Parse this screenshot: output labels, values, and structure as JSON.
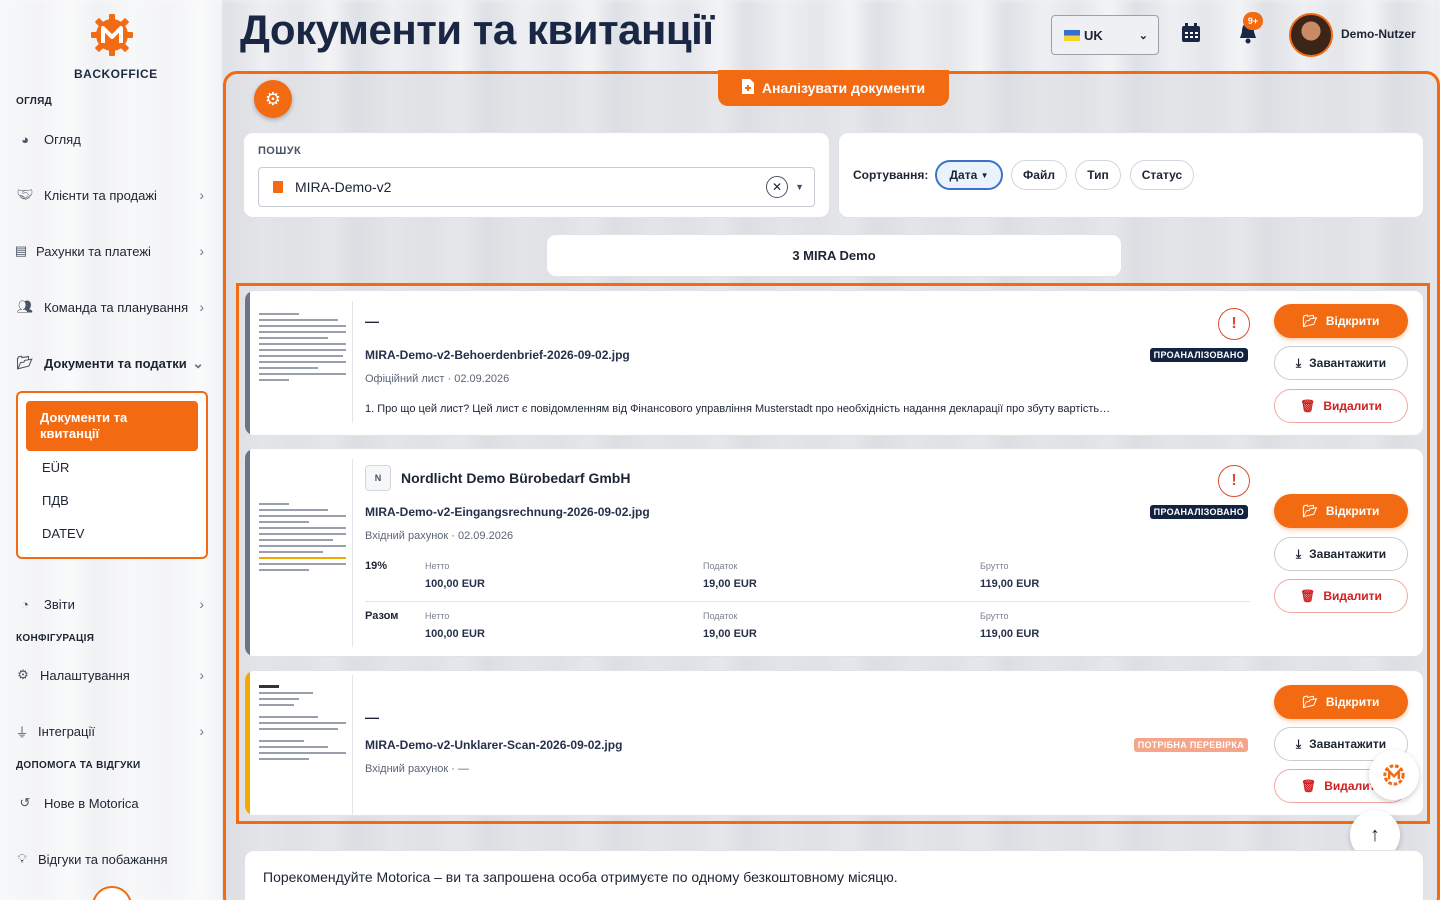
{
  "app": {
    "brand": "BACKOFFICE",
    "accent_color": "#f26a12",
    "dark_color": "#1a2744"
  },
  "header": {
    "title": "Документи та квитанції",
    "language": {
      "flag": "ukraine-flag",
      "value": "UK"
    },
    "notifications_badge": "9+",
    "user_name": "Demo-Nutzer"
  },
  "sidebar": {
    "sections": {
      "overview": "ОГЛЯД",
      "config": "КОНФІГУРАЦІЯ",
      "help": "ДОПОМОГА ТА ВІДГУКИ"
    },
    "items": [
      {
        "label": "Огляд",
        "icon": "dashboard-icon"
      },
      {
        "label": "Клієнти та продажі",
        "icon": "handshake-icon"
      },
      {
        "label": "Рахунки та платежі",
        "icon": "invoice-icon"
      },
      {
        "label": "Команда та планування",
        "icon": "team-icon"
      },
      {
        "label": "Документи та податки",
        "icon": "folder-open-icon"
      },
      {
        "label": "Звіти",
        "icon": "pie-chart-icon"
      },
      {
        "label": "Налаштування",
        "icon": "gear-icon"
      },
      {
        "label": "Інтеграції",
        "icon": "plug-icon"
      },
      {
        "label": "Нове в Motorica",
        "icon": "history-icon"
      },
      {
        "label": "Відгуки та побажання",
        "icon": "lightbulb-icon"
      }
    ],
    "subitems": [
      {
        "label": "Документи та квитанції"
      },
      {
        "label": "EÜR"
      },
      {
        "label": "ПДВ"
      },
      {
        "label": "DATEV"
      }
    ]
  },
  "toolbar": {
    "analyze_label": "Аналізувати документи"
  },
  "search": {
    "label": "ПОШУК",
    "value": "MIRA-Demo-v2"
  },
  "sort": {
    "label": "Сортування:",
    "options": [
      "Дата",
      "Файл",
      "Тип",
      "Статус"
    ],
    "active": "Дата"
  },
  "group": {
    "title": "3 MIRA Demo"
  },
  "documents": [
    {
      "title": "—",
      "file": "MIRA-Demo-v2-Behoerdenbrief-2026-09-02.jpg",
      "meta": "Офіційний лист · 02.09.2026",
      "status": "ПРОАНАЛІЗОВАНО",
      "summary": "1. Про що цей лист? Цей лист є повідомленням від Фінансового управління Musterstadt про необхідність надання декларації про збуту вартість…"
    },
    {
      "vendor_initial": "N",
      "title": "Nordlicht Demo Bürobedarf GmbH",
      "file": "MIRA-Demo-v2-Eingangsrechnung-2026-09-02.jpg",
      "meta": "Вхідний рахунок · 02.09.2026",
      "status": "ПРОАНАЛІЗОВАНО",
      "tax_rows": [
        {
          "rate": "19%",
          "net_label": "Нетто",
          "net": "100,00 EUR",
          "tax_label": "Податок",
          "tax": "19,00 EUR",
          "gross_label": "Брутто",
          "gross": "119,00 EUR"
        },
        {
          "rate": "Разом",
          "net_label": "Нетто",
          "net": "100,00 EUR",
          "tax_label": "Податок",
          "tax": "19,00 EUR",
          "gross_label": "Брутто",
          "gross": "119,00 EUR"
        }
      ]
    },
    {
      "title": "—",
      "file": "MIRA-Demo-v2-Unklarer-Scan-2026-09-02.jpg",
      "meta": "Вхідний рахунок · —",
      "status": "ПОТРІБНА ПЕРЕВІРКА"
    }
  ],
  "actions": {
    "open": "Відкрити",
    "download": "Завантажити",
    "delete": "Видалити",
    "delete_truncated": "Видалит"
  },
  "referral": {
    "text": "Порекомендуйте Motorica – ви та запрошена особа отримуєте по одному безкоштовному місяцю."
  }
}
